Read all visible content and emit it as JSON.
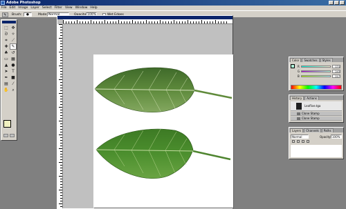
{
  "window": {
    "title": "Adobe Photoshop"
  },
  "menu": [
    "File",
    "Edit",
    "Image",
    "Layer",
    "Select",
    "Filter",
    "View",
    "Window",
    "Help"
  ],
  "options": {
    "brush_label": "Brush:",
    "mode_label": "Mode:",
    "mode_value": "Normal",
    "opacity_label": "Opacity:",
    "opacity_value": "100%",
    "wet_edges_label": "Wet Edges"
  },
  "color_panel": {
    "tabs": [
      "Color",
      "Swatches",
      "Styles"
    ],
    "sliders": [
      {
        "label": "R",
        "value": "174"
      },
      {
        "label": "G",
        "value": "243"
      },
      {
        "label": "B",
        "value": "217"
      }
    ]
  },
  "history_panel": {
    "tabs": [
      "History",
      "Actions"
    ],
    "snapshot": "Leaflive.tga",
    "items": [
      "Clone Stamp",
      "Clone Stamp"
    ]
  },
  "layers_panel": {
    "tabs": [
      "Layers",
      "Channels",
      "Paths"
    ],
    "mode_value": "Normal",
    "opacity_label": "Opacity:",
    "opacity_value": "100%"
  },
  "icons": {
    "tools": [
      "marquee-icon",
      "move-icon",
      "lasso-icon",
      "magic-wand-icon",
      "crop-icon",
      "slice-icon",
      "healing-icon",
      "brush-icon",
      "clone-stamp-icon",
      "history-brush-icon",
      "eraser-icon",
      "gradient-icon",
      "blur-icon",
      "dodge-icon",
      "path-select-icon",
      "type-icon",
      "pen-icon",
      "shape-icon",
      "notes-icon",
      "eyedropper-icon",
      "hand-icon",
      "zoom-icon"
    ]
  }
}
